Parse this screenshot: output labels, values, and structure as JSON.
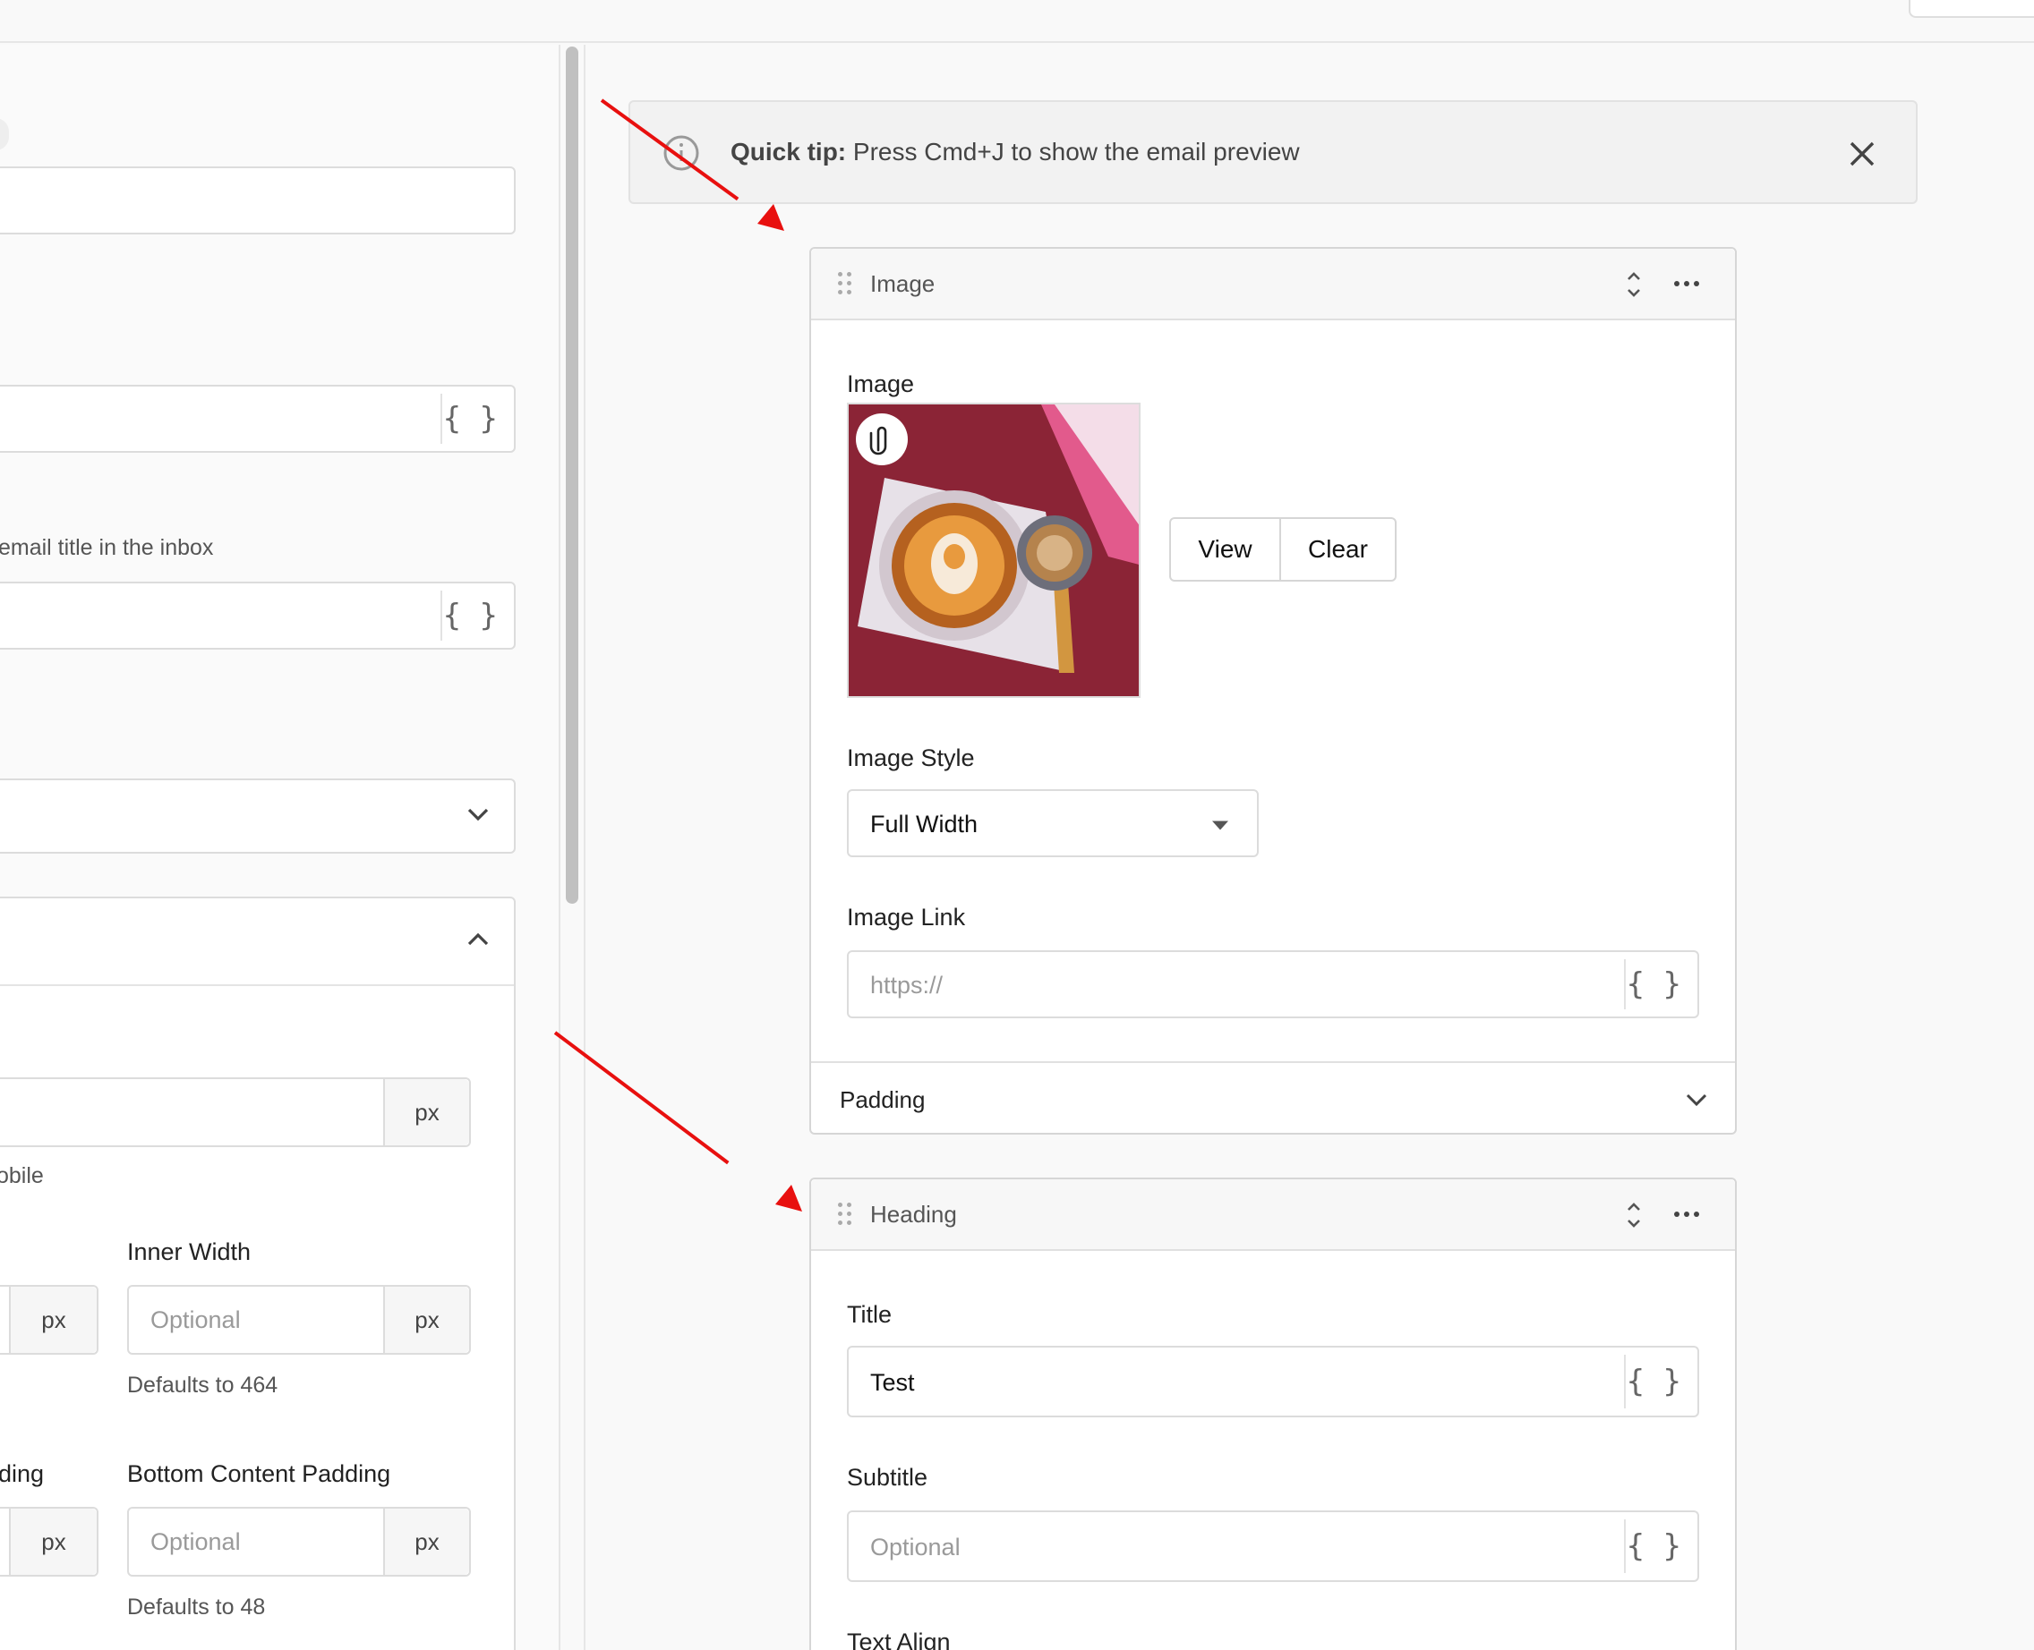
{
  "left_panel": {
    "title_help": "email title in the inbox",
    "mobile_help": "obile",
    "inner_width": {
      "label": "Inner Width",
      "placeholder": "Optional",
      "unit": "px",
      "help": "Defaults to 464"
    },
    "left_unit_1": "px",
    "left_unit_2": "px",
    "top_unit": "px",
    "padding_label_partial": "ding",
    "bottom_padding": {
      "label": "Bottom Content Padding",
      "placeholder": "Optional",
      "unit": "px",
      "help": "Defaults to 48"
    }
  },
  "tip": {
    "strong": "Quick tip:",
    "text": " Press Cmd+J to show the email preview"
  },
  "image_block": {
    "header": "Image",
    "image_label": "Image",
    "view_button": "View",
    "clear_button": "Clear",
    "style_label": "Image Style",
    "style_value": "Full Width",
    "link_label": "Image Link",
    "link_placeholder": "https://",
    "padding_label": "Padding"
  },
  "heading_block": {
    "header": "Heading",
    "title_label": "Title",
    "title_value": "Test",
    "subtitle_label": "Subtitle",
    "subtitle_placeholder": "Optional",
    "align_label": "Text Align"
  },
  "colors": {
    "annotation_arrow": "#e8100f",
    "border": "#d6d6d6",
    "panel_bg": "#f9f9f9"
  },
  "icons": [
    "info-icon",
    "close-icon",
    "drag-handle-icon",
    "expand-collapse-icon",
    "more-options-icon",
    "paperclip-icon",
    "caret-down-icon",
    "chevron-down-icon",
    "chevron-up-icon",
    "variable-braces-icon"
  ]
}
